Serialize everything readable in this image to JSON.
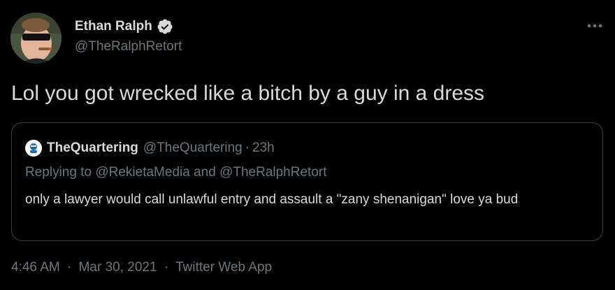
{
  "author": {
    "name": "Ethan Ralph",
    "handle": "@TheRalphRetort",
    "verified_icon": "verified-badge-icon"
  },
  "tweet": {
    "text": "Lol you got wrecked like a bitch by a guy in a dress"
  },
  "quote": {
    "name": "TheQuartering",
    "handle": "@TheQuartering",
    "dot": "·",
    "time": "23h",
    "replying_prefix": "Replying to",
    "replying_user1": "@RekietaMedia",
    "replying_and": "and",
    "replying_user2": "@TheRalphRetort",
    "text": "only a lawyer would call unlawful entry and assault a \"zany shenanigan\"  love ya bud"
  },
  "meta": {
    "time": "4:46 AM",
    "sep1": "·",
    "date": "Mar 30, 2021",
    "sep2": "·",
    "source": "Twitter Web App"
  },
  "colors": {
    "background": "#000000",
    "text": "#d9d9d9",
    "secondary": "#6e767d",
    "border": "#3d4146",
    "verified": "#d9d9d9"
  }
}
